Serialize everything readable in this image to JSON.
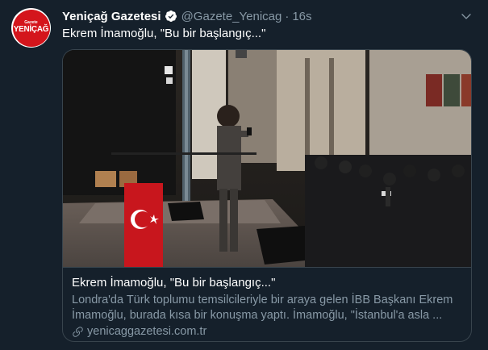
{
  "tweet": {
    "avatar_logo": {
      "top_text": "Gazete",
      "main_text": "YENİÇAĞ"
    },
    "author_name": "Yeniçağ Gazetesi",
    "author_handle": "@Gazete_Yenicag",
    "separator": "·",
    "timestamp": "16s",
    "text": "Ekrem İmamoğlu, \"Bu bir başlangıç...\""
  },
  "card": {
    "media_icon": "video-thumbnail",
    "title": "Ekrem İmamoğlu, \"Bu bir başlangıç...\"",
    "description": "Londra'da Türk toplumu temsilcileriyle bir araya gelen İBB Başkanı Ekrem İmamoğlu, burada kısa bir konuşma yaptı. İmamoğlu, \"İstanbul'a asla ...",
    "domain": "yenicaggazetesi.com.tr"
  },
  "colors": {
    "background": "#15202b",
    "border": "#38444d",
    "secondary_text": "#8899a6",
    "brand_red": "#d4151c",
    "verified_blue": "#1da1f2"
  }
}
